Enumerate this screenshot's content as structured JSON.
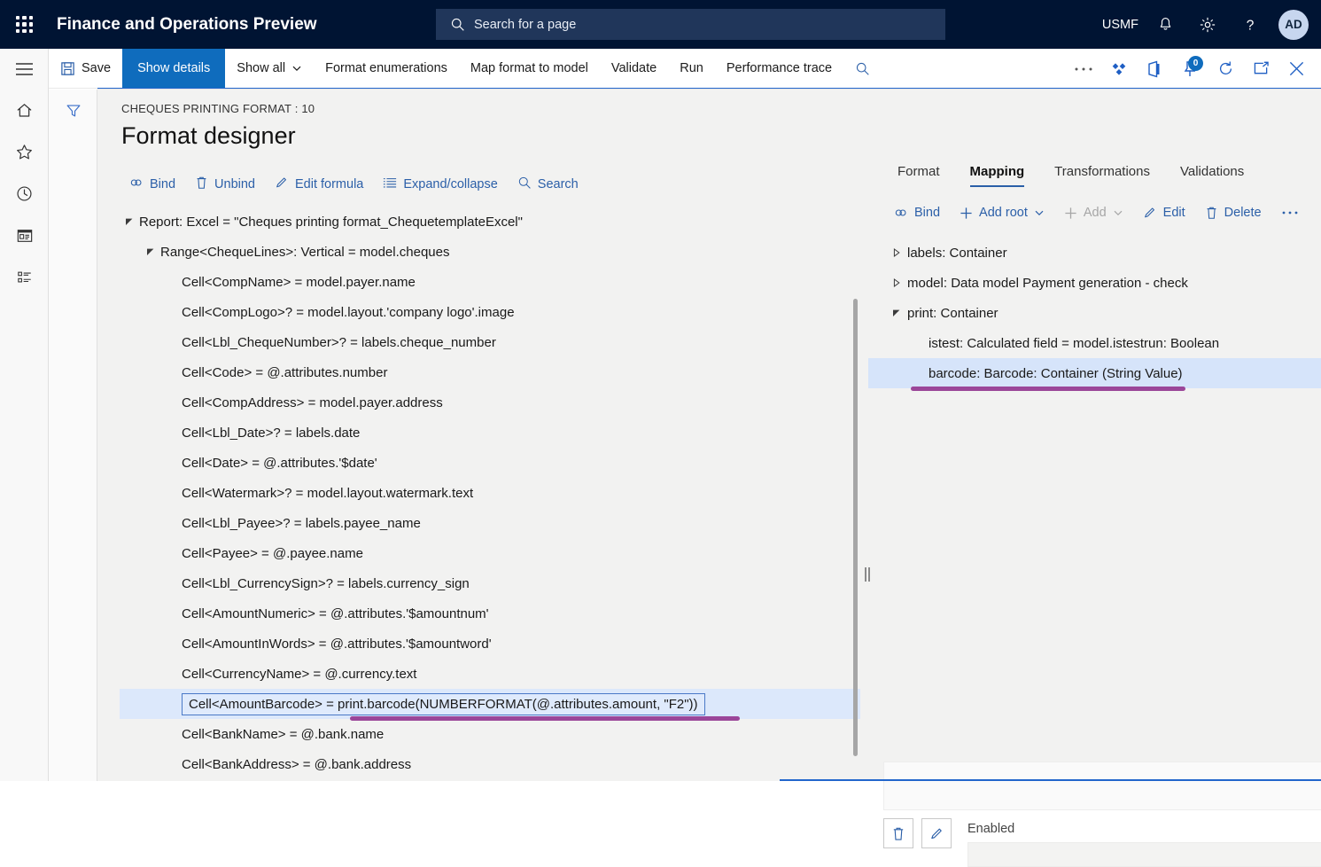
{
  "topbar": {
    "waffle_icon": "app-launcher-icon",
    "app_title": "Finance and Operations Preview",
    "search_placeholder": "Search for a page",
    "search_icon": "search-icon",
    "company": "USMF",
    "notification_icon": "bell-icon",
    "settings_icon": "gear-icon",
    "help_icon": "question-mark-icon",
    "avatar_initials": "AD"
  },
  "navrail": {
    "items": [
      {
        "name": "hamburger-icon",
        "label": "Menu"
      },
      {
        "name": "home-icon",
        "label": "Home"
      },
      {
        "name": "star-icon",
        "label": "Favorites"
      },
      {
        "name": "clock-icon",
        "label": "Recent"
      },
      {
        "name": "workspace-icon",
        "label": "Workspaces"
      },
      {
        "name": "modules-icon",
        "label": "Modules"
      }
    ]
  },
  "filterstrip": {
    "filter_icon": "filter-icon"
  },
  "commandbar": {
    "save_label": "Save",
    "show_details_label": "Show details",
    "show_all_label": "Show all",
    "format_enumerations_label": "Format enumerations",
    "map_format_to_model_label": "Map format to model",
    "validate_label": "Validate",
    "run_label": "Run",
    "performance_trace_label": "Performance trace",
    "search_icon": "search-icon",
    "overflow_icon": "ellipsis-icon",
    "share_icon": "share-icon",
    "office_icon": "office-app-icon",
    "pin_icon": "pin-icon",
    "pin_badge": "0",
    "refresh_icon": "refresh-icon",
    "popout_icon": "open-in-new-window-icon",
    "close_icon": "close-icon"
  },
  "page": {
    "breadcrumb": "CHEQUES PRINTING FORMAT : 10",
    "title": "Format designer"
  },
  "subtoolbar": {
    "items": [
      {
        "label": "Bind",
        "icon": "bind-link-icon",
        "disabled": false
      },
      {
        "label": "Unbind",
        "icon": "trash-icon",
        "disabled": false
      },
      {
        "label": "Edit formula",
        "icon": "pencil-icon",
        "disabled": false
      },
      {
        "label": "Expand/collapse",
        "icon": "list-lines-icon",
        "disabled": false
      },
      {
        "label": "Search",
        "icon": "search-icon",
        "disabled": false
      }
    ]
  },
  "format_tree": {
    "rows": [
      {
        "indent": 0,
        "twisty": "expanded",
        "text": "Report: Excel = \"Cheques printing format_ChequetemplateExcel\"",
        "selected": false
      },
      {
        "indent": 1,
        "twisty": "expanded",
        "text": "Range<ChequeLines>: Vertical = model.cheques",
        "selected": false
      },
      {
        "indent": 2,
        "twisty": "none",
        "text": "Cell<CompName> = model.payer.name",
        "selected": false
      },
      {
        "indent": 2,
        "twisty": "none",
        "text": "Cell<CompLogo>? = model.layout.'company logo'.image",
        "selected": false
      },
      {
        "indent": 2,
        "twisty": "none",
        "text": "Cell<Lbl_ChequeNumber>? = labels.cheque_number",
        "selected": false
      },
      {
        "indent": 2,
        "twisty": "none",
        "text": "Cell<Code> = @.attributes.number",
        "selected": false
      },
      {
        "indent": 2,
        "twisty": "none",
        "text": "Cell<CompAddress> = model.payer.address",
        "selected": false
      },
      {
        "indent": 2,
        "twisty": "none",
        "text": "Cell<Lbl_Date>? = labels.date",
        "selected": false
      },
      {
        "indent": 2,
        "twisty": "none",
        "text": "Cell<Date> = @.attributes.'$date'",
        "selected": false
      },
      {
        "indent": 2,
        "twisty": "none",
        "text": "Cell<Watermark>? = model.layout.watermark.text",
        "selected": false
      },
      {
        "indent": 2,
        "twisty": "none",
        "text": "Cell<Lbl_Payee>? = labels.payee_name",
        "selected": false
      },
      {
        "indent": 2,
        "twisty": "none",
        "text": "Cell<Payee> = @.payee.name",
        "selected": false
      },
      {
        "indent": 2,
        "twisty": "none",
        "text": "Cell<Lbl_CurrencySign>? = labels.currency_sign",
        "selected": false
      },
      {
        "indent": 2,
        "twisty": "none",
        "text": "Cell<AmountNumeric> = @.attributes.'$amountnum'",
        "selected": false
      },
      {
        "indent": 2,
        "twisty": "none",
        "text": "Cell<AmountInWords> = @.attributes.'$amountword'",
        "selected": false
      },
      {
        "indent": 2,
        "twisty": "none",
        "text": "Cell<CurrencyName> = @.currency.text",
        "selected": false
      },
      {
        "indent": 2,
        "twisty": "none",
        "text": "Cell<AmountBarcode> = print.barcode(NUMBERFORMAT(@.attributes.amount, \"F2\"))",
        "selected": true
      },
      {
        "indent": 2,
        "twisty": "none",
        "text": "Cell<BankName> = @.bank.name",
        "selected": false
      },
      {
        "indent": 2,
        "twisty": "none",
        "text": "Cell<BankAddress> = @.bank.address",
        "selected": false
      }
    ]
  },
  "right_panel": {
    "tabs": [
      {
        "label": "Format",
        "active": false
      },
      {
        "label": "Mapping",
        "active": true
      },
      {
        "label": "Transformations",
        "active": false
      },
      {
        "label": "Validations",
        "active": false
      }
    ],
    "toolbar": [
      {
        "label": "Bind",
        "icon": "bind-link-icon",
        "disabled": false,
        "chevron": false
      },
      {
        "label": "Add root",
        "icon": "plus-icon",
        "disabled": false,
        "chevron": true
      },
      {
        "label": "Add",
        "icon": "plus-icon",
        "disabled": true,
        "chevron": true
      },
      {
        "label": "Edit",
        "icon": "pencil-icon",
        "disabled": false,
        "chevron": false
      },
      {
        "label": "Delete",
        "icon": "trash-icon",
        "disabled": false,
        "chevron": false
      },
      {
        "label": "",
        "icon": "ellipsis-icon",
        "disabled": false,
        "chevron": false
      }
    ],
    "tree": [
      {
        "indent": 0,
        "twisty": "collapsed",
        "text": "labels: Container",
        "selected": false
      },
      {
        "indent": 0,
        "twisty": "collapsed",
        "text": "model: Data model Payment generation - check",
        "selected": false
      },
      {
        "indent": 0,
        "twisty": "expanded",
        "text": "print: Container",
        "selected": false
      },
      {
        "indent": 1,
        "twisty": "none",
        "text": "istest: Calculated field = model.istestrun: Boolean",
        "selected": false
      },
      {
        "indent": 1,
        "twisty": "none",
        "text": "barcode: Barcode: Container (String Value)",
        "selected": true
      }
    ],
    "detail": {
      "delete_icon": "trash-icon",
      "edit_icon": "pencil-icon",
      "enabled_label": "Enabled",
      "enabled_value": ""
    }
  },
  "colors": {
    "brand_dark": "#001433",
    "accent_blue": "#0f6cbd",
    "link_blue": "#2b5fa8",
    "selection_blue": "#d6e4fa",
    "annotation_purple": "#9b4699",
    "page_bg": "#f2f2f1"
  }
}
